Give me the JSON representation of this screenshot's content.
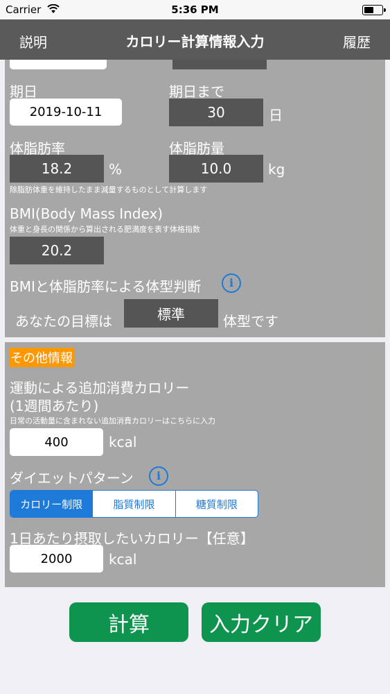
{
  "status": {
    "carrier": "Carrier",
    "time": "5:36 PM"
  },
  "nav": {
    "left": "説明",
    "title": "カロリー計算情報入力",
    "right": "履歴"
  },
  "main": {
    "date_label": "期日",
    "date_value": "2019-10-11",
    "days_label": "期日まで",
    "days_value": "30",
    "days_unit": "日",
    "bodyfat_rate_label": "体脂肪率",
    "bodyfat_rate_value": "18.2",
    "bodyfat_rate_unit": "%",
    "bodyfat_mass_label": "体脂肪量",
    "bodyfat_mass_value": "10.0",
    "bodyfat_mass_unit": "kg",
    "bodyfat_note": "除脂肪体重を維持したまま減量するものとして計算します",
    "bmi_label": "BMI(Body Mass Index)",
    "bmi_note": "体重と身長の関係から算出される肥満度を表す体格指数",
    "bmi_value": "20.2",
    "judge_label": "BMIと体脂肪率による体型判断",
    "goal_prefix": "あなたの目標は",
    "goal_value": "標準",
    "goal_suffix": "体型です"
  },
  "other": {
    "header": "その他情報",
    "exercise_label_line1": "運動による追加消費カロリー",
    "exercise_label_line2": "(1週間あたり)",
    "exercise_note": "日常の活動量に含まれない追加消費カロリーはこちらに入力",
    "exercise_value": "400",
    "exercise_unit": "kcal",
    "diet_label": "ダイエットパターン",
    "diet_options": [
      "カロリー制限",
      "脂質制限",
      "糖質制限"
    ],
    "intake_label": "1日あたり摂取したいカロリー【任意】",
    "intake_value": "2000",
    "intake_unit": "kcal"
  },
  "buttons": {
    "calculate": "計算",
    "clear": "入力クリア"
  },
  "colors": {
    "accent": "#1e7ad8",
    "badge": "#ff9800",
    "button": "#0f9450",
    "panel": "#a7a7a7",
    "navbar": "#5a5a5a"
  }
}
